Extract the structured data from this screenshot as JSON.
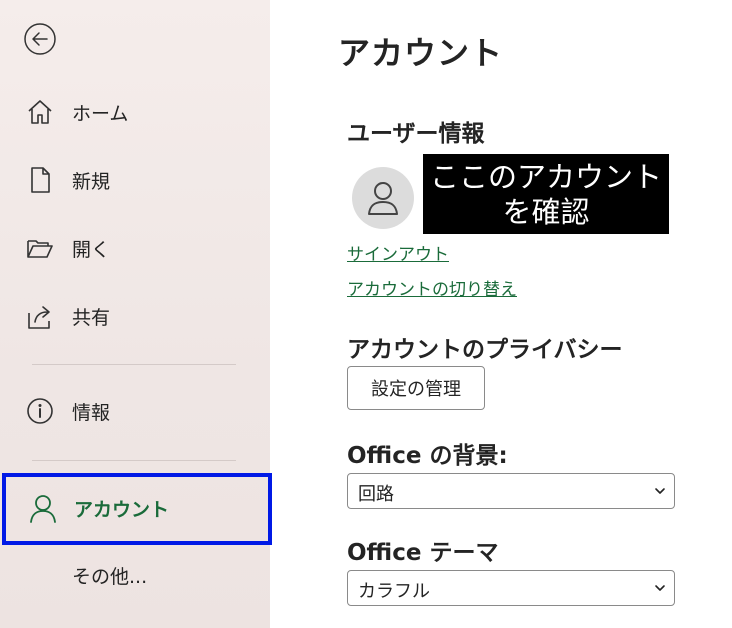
{
  "sidebar": {
    "back_icon": "back-arrow-icon",
    "items": [
      {
        "label": "ホーム",
        "icon": "home-icon"
      },
      {
        "label": "新規",
        "icon": "new-document-icon"
      },
      {
        "label": "開く",
        "icon": "open-folder-icon"
      },
      {
        "label": "共有",
        "icon": "share-icon"
      },
      {
        "label": "情報",
        "icon": "info-icon"
      },
      {
        "label": "アカウント",
        "icon": "person-icon",
        "selected": true,
        "highlight_color": "#0019e6"
      },
      {
        "label": "その他..."
      }
    ]
  },
  "main": {
    "title": "アカウント",
    "user_info": {
      "heading": "ユーザー情報",
      "avatar_icon": "person-avatar-icon",
      "callout": {
        "line1": "ここのアカウント",
        "line2": "を確認"
      },
      "sign_out": "サインアウト",
      "switch_account": "アカウントの切り替え"
    },
    "privacy": {
      "heading": "アカウントのプライバシー",
      "manage_button": "設定の管理"
    },
    "background": {
      "heading": "Office の背景:",
      "selected": "回路"
    },
    "theme": {
      "heading": "Office テーマ",
      "selected": "カラフル"
    }
  },
  "colors": {
    "accent_green": "#1a6b3a",
    "highlight_blue": "#0019e6",
    "sidebar_bg": "#f2e9e7"
  }
}
